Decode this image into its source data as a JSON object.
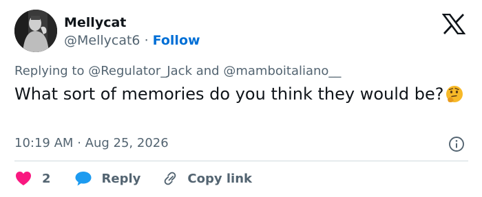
{
  "author": {
    "name": "Mellycat",
    "handle": "@Mellycat6",
    "separator": "·",
    "follow_label": "Follow"
  },
  "reply_context": {
    "prefix": "Replying to",
    "mention_1": "@Regulator_Jack",
    "conjunction": "and",
    "mention_2": "@mamboitaliano__"
  },
  "tweet": {
    "text": "What sort of memories do you think they would be?",
    "emoji": "thinking-face-emoji"
  },
  "meta": {
    "time": "10:19 AM",
    "separator": "·",
    "date": "Aug 25, 2026"
  },
  "actions": {
    "like_count": "2",
    "reply_label": "Reply",
    "copy_link_label": "Copy link"
  },
  "colors": {
    "link": "#006fd6",
    "like": "#f91880",
    "reply": "#1d9bf0",
    "muted": "#536471",
    "divider": "#cfd9de"
  },
  "icons": [
    "x-logo-icon",
    "info-icon",
    "heart-icon",
    "speech-bubble-icon",
    "link-icon"
  ]
}
